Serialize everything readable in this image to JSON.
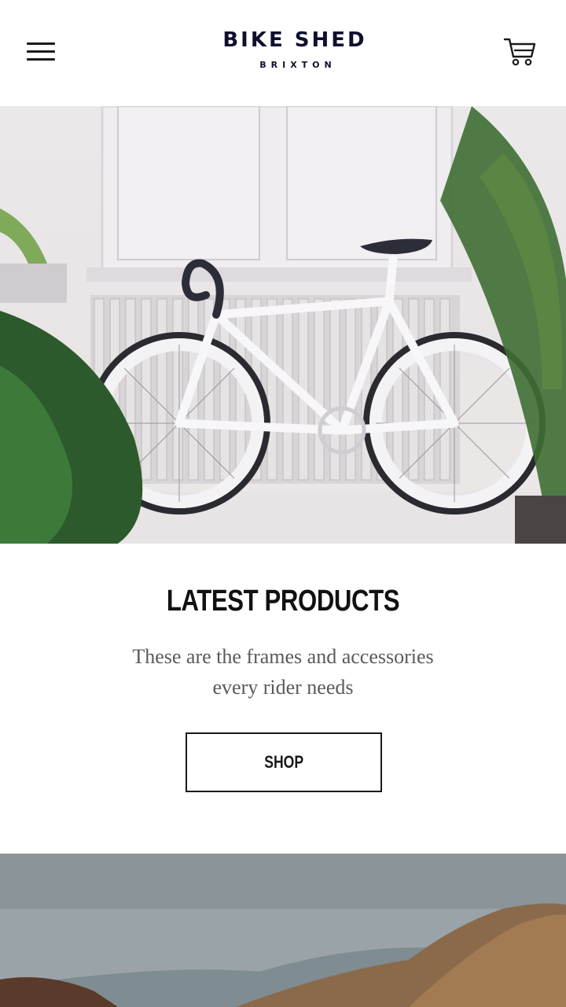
{
  "header": {
    "logo_main": "BIKE SHED",
    "logo_sub": "BRIXTON",
    "menu_icon": "hamburger-menu-icon",
    "cart_icon": "shopping-cart-icon"
  },
  "hero": {
    "image_subject": "white fixed-gear bicycle in front of radiator with plants"
  },
  "products": {
    "title": "LATEST PRODUCTS",
    "description": "These are the frames and accessories every rider needs",
    "shop_label": "SHOP"
  },
  "landscape": {
    "image_subject": "mountain valley landscape"
  },
  "colors": {
    "brand_navy": "#0f1030",
    "text_dark": "#1a1a1a",
    "text_muted": "#5a5a5a",
    "background": "#ffffff"
  }
}
